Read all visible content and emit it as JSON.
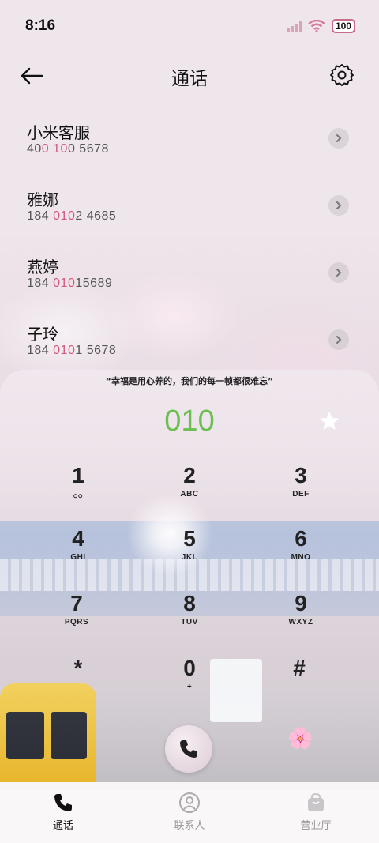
{
  "status_bar": {
    "time": "8:16",
    "battery": "100"
  },
  "header": {
    "title": "通话"
  },
  "contacts": [
    {
      "name": "小米客服",
      "number_parts": [
        "40",
        "0",
        " ",
        "10",
        "0 5678"
      ]
    },
    {
      "name": "雅娜",
      "number_parts": [
        "184 ",
        "010",
        "2 4685"
      ]
    },
    {
      "name": "燕婷",
      "number_parts": [
        "184 ",
        "010",
        "15689"
      ]
    },
    {
      "name": "子玲",
      "number_parts": [
        "184 ",
        "010",
        "1 5678"
      ]
    }
  ],
  "dial": {
    "slogan": "“幸福是用心养的，我们的每一帧都很难忘”",
    "display": "010"
  },
  "keypad": [
    {
      "digit": "1",
      "letters": "ဝဝ"
    },
    {
      "digit": "2",
      "letters": "ABC"
    },
    {
      "digit": "3",
      "letters": "DEF"
    },
    {
      "digit": "4",
      "letters": "GHI"
    },
    {
      "digit": "5",
      "letters": "JKL"
    },
    {
      "digit": "6",
      "letters": "MNO"
    },
    {
      "digit": "7",
      "letters": "PQRS"
    },
    {
      "digit": "8",
      "letters": "TUV"
    },
    {
      "digit": "9",
      "letters": "WXYZ"
    },
    {
      "digit": "*",
      "letters": ""
    },
    {
      "digit": "0",
      "letters": "+"
    },
    {
      "digit": "#",
      "letters": ""
    }
  ],
  "bottom_nav": [
    {
      "label": "通话",
      "icon": "phone-icon",
      "active": true
    },
    {
      "label": "联系人",
      "icon": "person-icon",
      "active": false
    },
    {
      "label": "营业厅",
      "icon": "bag-icon",
      "active": false
    }
  ],
  "colors": {
    "dial_display": "#6bbf4e",
    "number_highlight": "#d25a7e"
  }
}
